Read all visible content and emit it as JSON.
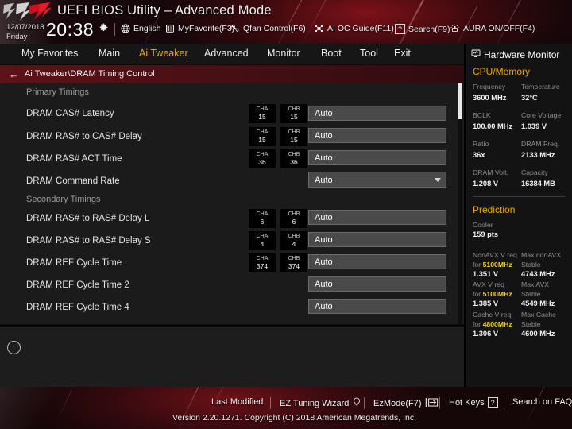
{
  "header": {
    "title": "UEFI BIOS Utility – Advanced Mode",
    "logo_alt": "rog-logo",
    "date": "12/07/2018",
    "weekday": "Friday",
    "time": "20:38",
    "items": [
      {
        "label": "English",
        "icon": "globe-icon"
      },
      {
        "label": "MyFavorite(F3)",
        "icon": "favorite-icon"
      },
      {
        "label": "Qfan Control(F6)",
        "icon": "fan-icon"
      },
      {
        "label": "AI OC Guide(F11)",
        "icon": "ai-oc-icon"
      },
      {
        "label": "Search(F9)",
        "icon": "question-box-icon"
      },
      {
        "label": "AURA ON/OFF(F4)",
        "icon": "aura-icon"
      }
    ]
  },
  "menu": {
    "items": [
      {
        "label": "My Favorites",
        "active": false
      },
      {
        "label": "Main",
        "active": false
      },
      {
        "label": "Ai Tweaker",
        "active": true
      },
      {
        "label": "Advanced",
        "active": false
      },
      {
        "label": "Monitor",
        "active": false
      },
      {
        "label": "Boot",
        "active": false
      },
      {
        "label": "Tool",
        "active": false
      },
      {
        "label": "Exit",
        "active": false
      }
    ],
    "active_color": "#f0a500"
  },
  "breadcrumb": {
    "back_icon": "back-arrow-icon",
    "path": "Ai Tweaker\\DRAM Timing Control"
  },
  "content": {
    "sections": [
      {
        "type": "section",
        "label": "Primary Timings"
      },
      {
        "type": "option",
        "label": "DRAM CAS# Latency",
        "cha": {
          "label": "CHA",
          "value": "15"
        },
        "chb": {
          "label": "CHB",
          "value": "15"
        },
        "value": "Auto",
        "control": "text"
      },
      {
        "type": "option",
        "label": "DRAM RAS# to CAS# Delay",
        "cha": {
          "label": "CHA",
          "value": "15"
        },
        "chb": {
          "label": "CHB",
          "value": "15"
        },
        "value": "Auto",
        "control": "text"
      },
      {
        "type": "option",
        "label": "DRAM RAS# ACT Time",
        "cha": {
          "label": "CHA",
          "value": "36"
        },
        "chb": {
          "label": "CHB",
          "value": "36"
        },
        "value": "Auto",
        "control": "text"
      },
      {
        "type": "option",
        "label": "DRAM Command Rate",
        "cha": null,
        "chb": null,
        "value": "Auto",
        "control": "dropdown"
      },
      {
        "type": "section",
        "label": "Secondary Timings"
      },
      {
        "type": "option",
        "label": "DRAM RAS# to RAS# Delay L",
        "cha": {
          "label": "CHA",
          "value": "6"
        },
        "chb": {
          "label": "CHB",
          "value": "6"
        },
        "value": "Auto",
        "control": "text"
      },
      {
        "type": "option",
        "label": "DRAM RAS# to RAS# Delay S",
        "cha": {
          "label": "CHA",
          "value": "4"
        },
        "chb": {
          "label": "CHB",
          "value": "4"
        },
        "value": "Auto",
        "control": "text"
      },
      {
        "type": "option",
        "label": "DRAM REF Cycle Time",
        "cha": {
          "label": "CHA",
          "value": "374"
        },
        "chb": {
          "label": "CHB",
          "value": "374"
        },
        "value": "Auto",
        "control": "text"
      },
      {
        "type": "option",
        "label": "DRAM REF Cycle Time 2",
        "cha": null,
        "chb": null,
        "value": "Auto",
        "control": "text"
      },
      {
        "type": "option",
        "label": "DRAM REF Cycle Time 4",
        "cha": null,
        "chb": null,
        "value": "Auto",
        "control": "text"
      }
    ]
  },
  "help": {
    "info_icon": "info-icon",
    "text": ""
  },
  "rpanel": {
    "title": "Hardware Monitor",
    "title_icon": "monitor-icon",
    "cpu_memory": {
      "heading": "CPU/Memory",
      "pairs": [
        {
          "k1": "Frequency",
          "v1": "3600 MHz",
          "k2": "Temperature",
          "v2": "32°C"
        },
        {
          "k1": "BCLK",
          "v1": "100.00 MHz",
          "k2": "Core Voltage",
          "v2": "1.039 V"
        },
        {
          "k1": "Ratio",
          "v1": "36x",
          "k2": "DRAM Freq.",
          "v2": "2133 MHz"
        },
        {
          "k1": "DRAM Volt.",
          "v1": "1.208 V",
          "k2": "Capacity",
          "v2": "16384 MB"
        }
      ]
    },
    "prediction": {
      "heading": "Prediction",
      "cooler": {
        "label": "Cooler",
        "value": "159 pts"
      },
      "rows": [
        {
          "k1_pre": "NonAVX V req",
          "k1_for": "for ",
          "k1_hl": "5100MHz",
          "v1": "1.351 V",
          "k2_a": "Max nonAVX",
          "k2_b": "Stable",
          "v2": "4743 MHz"
        },
        {
          "k1_pre": "AVX V req",
          "k1_for": "for ",
          "k1_hl": "5100MHz",
          "v1": "1.385 V",
          "k2_a": "Max AVX",
          "k2_b": "Stable",
          "v2": "4549 MHz"
        },
        {
          "k1_pre": "Cache V req",
          "k1_for": "for ",
          "k1_hl": "4800MHz",
          "v1": "1.306 V",
          "k2_a": "Max Cache",
          "k2_b": "Stable",
          "v2": "4600 MHz"
        }
      ],
      "highlight_color": "#f5d800"
    }
  },
  "footer": {
    "items": [
      {
        "label": "Last Modified",
        "icon": ""
      },
      {
        "label": "EZ Tuning Wizard",
        "icon": "bulb-icon"
      },
      {
        "label": "EzMode(F7)",
        "icon": "exit-arrow-icon"
      },
      {
        "label": "Hot Keys",
        "icon": "question-box-icon"
      },
      {
        "label": "Search on FAQ",
        "icon": ""
      }
    ],
    "version": "Version 2.20.1271. Copyright (C) 2018 American Megatrends, Inc."
  }
}
